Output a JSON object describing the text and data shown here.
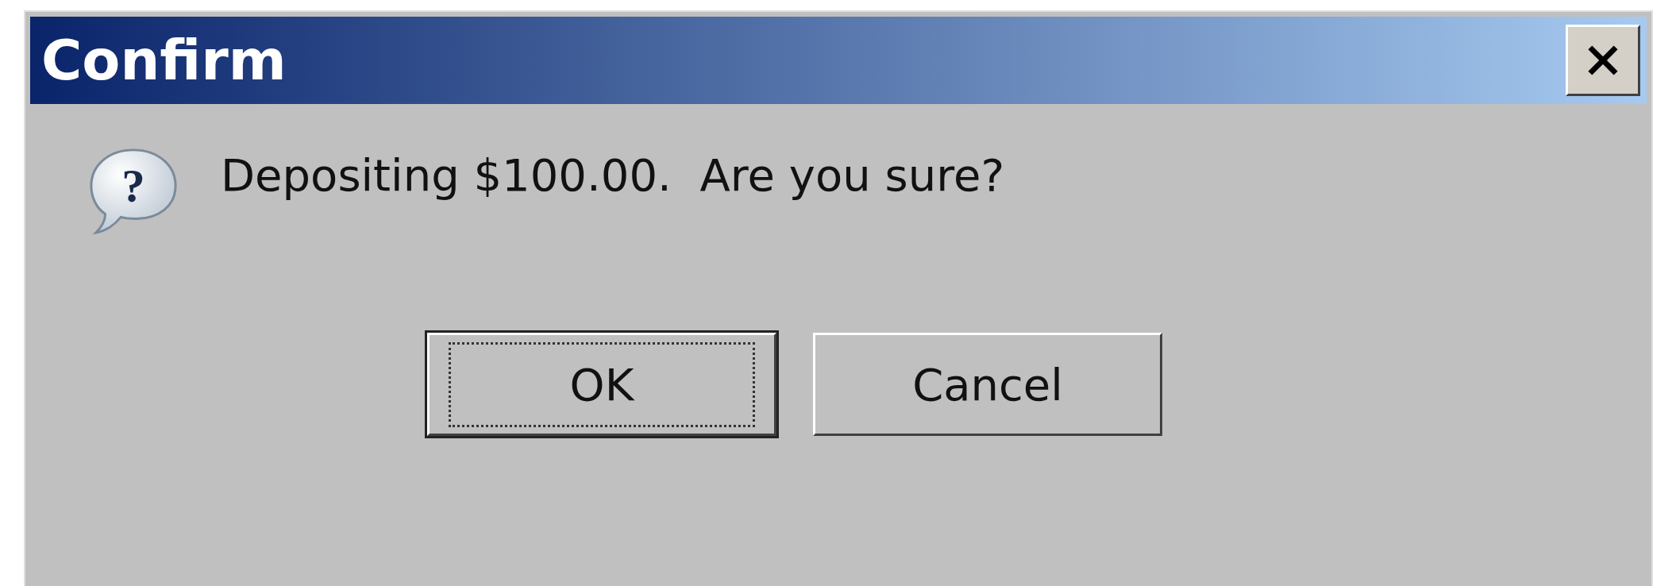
{
  "window": {
    "title": "Confirm"
  },
  "message": {
    "icon_glyph": "?",
    "text": "Depositing $100.00.  Are you sure?"
  },
  "buttons": [
    {
      "label": "OK",
      "default": true
    },
    {
      "label": "Cancel",
      "default": false
    }
  ]
}
